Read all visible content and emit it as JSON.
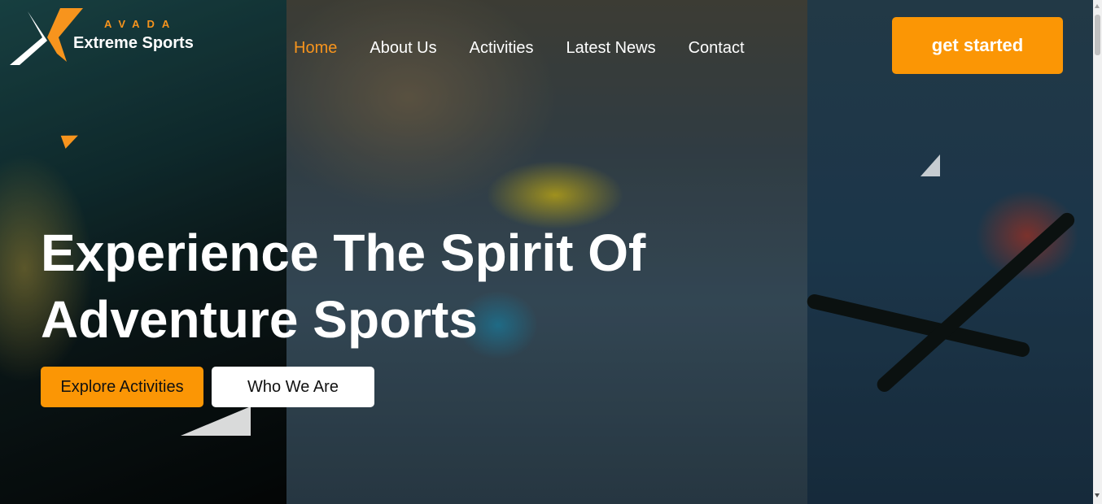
{
  "logo": {
    "top_text": "AVADA",
    "name": "Extreme Sports",
    "icon": "x-logo-icon"
  },
  "nav": {
    "items": [
      {
        "label": "Home",
        "active": true
      },
      {
        "label": "About Us",
        "active": false
      },
      {
        "label": "Activities",
        "active": false
      },
      {
        "label": "Latest News",
        "active": false
      },
      {
        "label": "Contact",
        "active": false
      }
    ]
  },
  "header": {
    "cta_label": "get started"
  },
  "hero": {
    "headline_line1": "Experience The Spirit Of",
    "headline_line2": "Adventure Sports",
    "primary_button": "Explore Activities",
    "secondary_button": "Who We Are",
    "images": [
      "skateboarder-photo",
      "rock-climber-photo",
      "skier-photo"
    ]
  },
  "colors": {
    "accent": "#fb9605",
    "nav_active": "#f7941d",
    "text": "#ffffff"
  }
}
